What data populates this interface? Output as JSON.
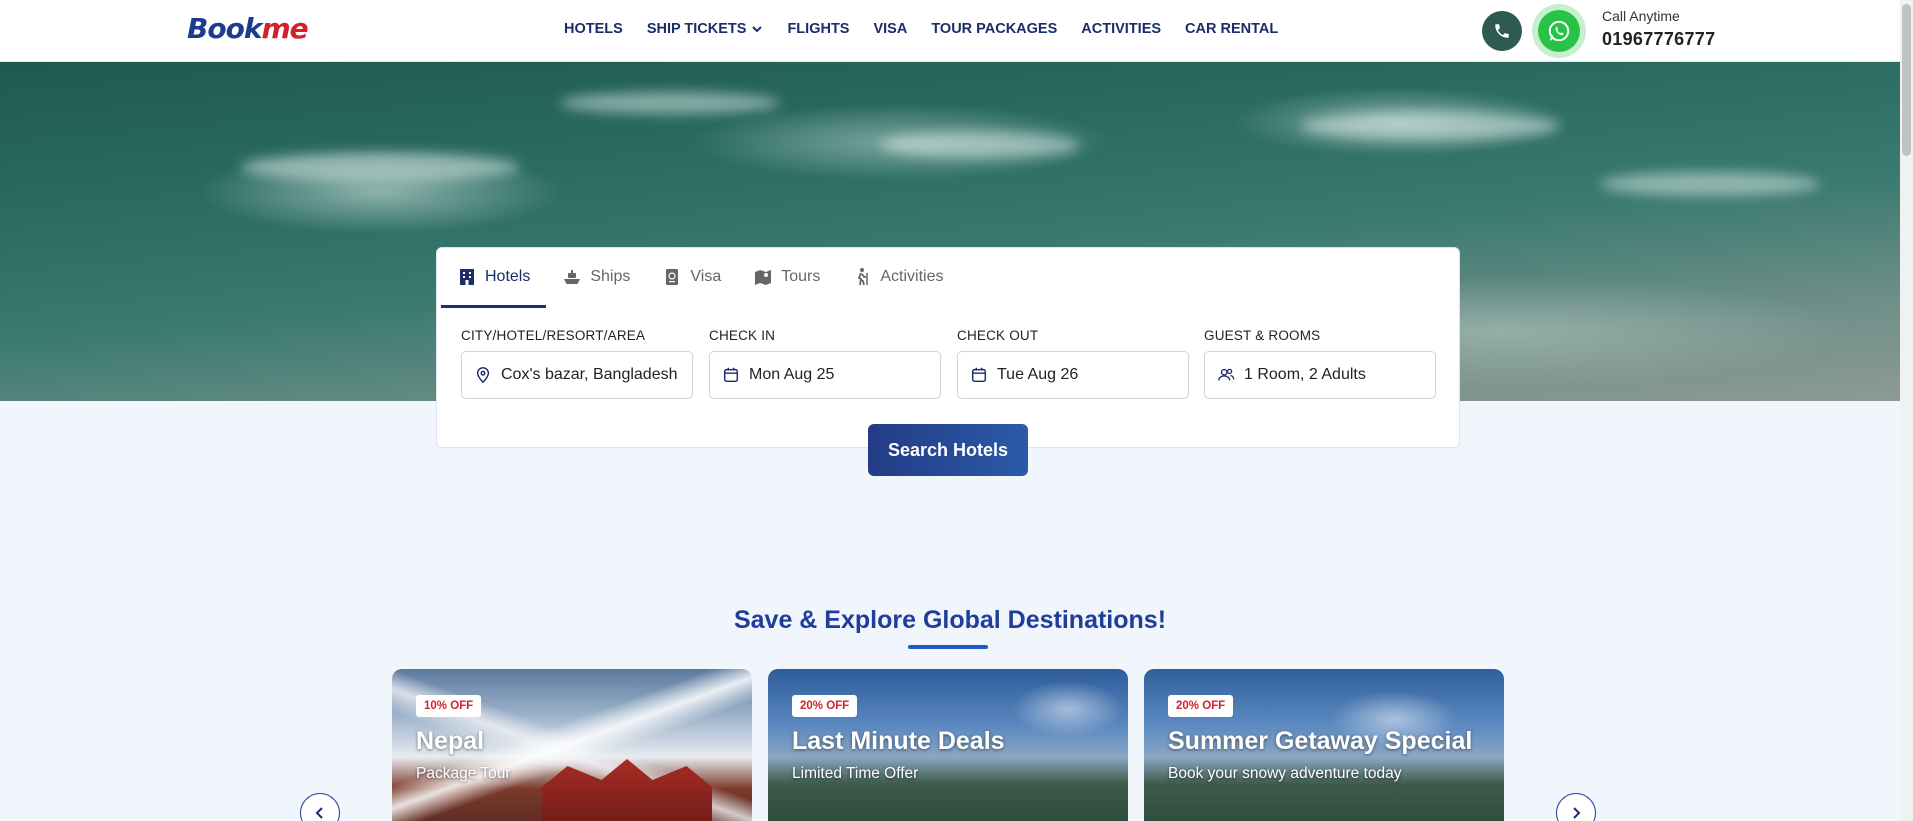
{
  "header": {
    "logo_b": "Book",
    "logo_me": "me",
    "nav": [
      {
        "label": "HOTELS"
      },
      {
        "label": "SHIP TICKETS",
        "has_dropdown": true
      },
      {
        "label": "FLIGHTS"
      },
      {
        "label": "VISA"
      },
      {
        "label": "TOUR PACKAGES"
      },
      {
        "label": "ACTIVITIES"
      },
      {
        "label": "CAR RENTAL"
      }
    ],
    "call_label": "Call Anytime",
    "call_number": "01967776777",
    "icons": [
      "phone-icon",
      "whatsapp-icon"
    ]
  },
  "search": {
    "tabs": [
      {
        "label": "Hotels",
        "icon": "hotel-icon",
        "active": true
      },
      {
        "label": "Ships",
        "icon": "ship-icon",
        "active": false
      },
      {
        "label": "Visa",
        "icon": "passport-icon",
        "active": false
      },
      {
        "label": "Tours",
        "icon": "map-icon",
        "active": false
      },
      {
        "label": "Activities",
        "icon": "hiking-icon",
        "active": false
      }
    ],
    "fields": [
      {
        "label": "CITY/HOTEL/RESORT/AREA",
        "value": "Cox's bazar, Bangladesh",
        "icon": "location-pin-icon"
      },
      {
        "label": "CHECK IN",
        "value": "Mon Aug 25",
        "icon": "calendar-icon"
      },
      {
        "label": "CHECK OUT",
        "value": "Tue Aug 26",
        "icon": "calendar-icon"
      },
      {
        "label": "GUEST & ROOMS",
        "value": "1 Room, 2 Adults",
        "icon": "users-icon"
      }
    ],
    "button_label": "Search Hotels"
  },
  "destinations": {
    "title": "Save & Explore Global Destinations!",
    "cards": [
      {
        "badge": "10% OFF",
        "title": "Nepal",
        "subtitle": "Package Tour"
      },
      {
        "badge": "20% OFF",
        "title": "Last Minute Deals",
        "subtitle": "Limited Time Offer"
      },
      {
        "badge": "20% OFF",
        "title": "Summer Getaway Special",
        "subtitle": "Book your snowy adventure today"
      }
    ]
  },
  "colors": {
    "brand_blue": "#1b2d6b",
    "brand_red": "#d3202c",
    "whatsapp_green": "#27c346",
    "page_bg": "#f0f6fc"
  }
}
